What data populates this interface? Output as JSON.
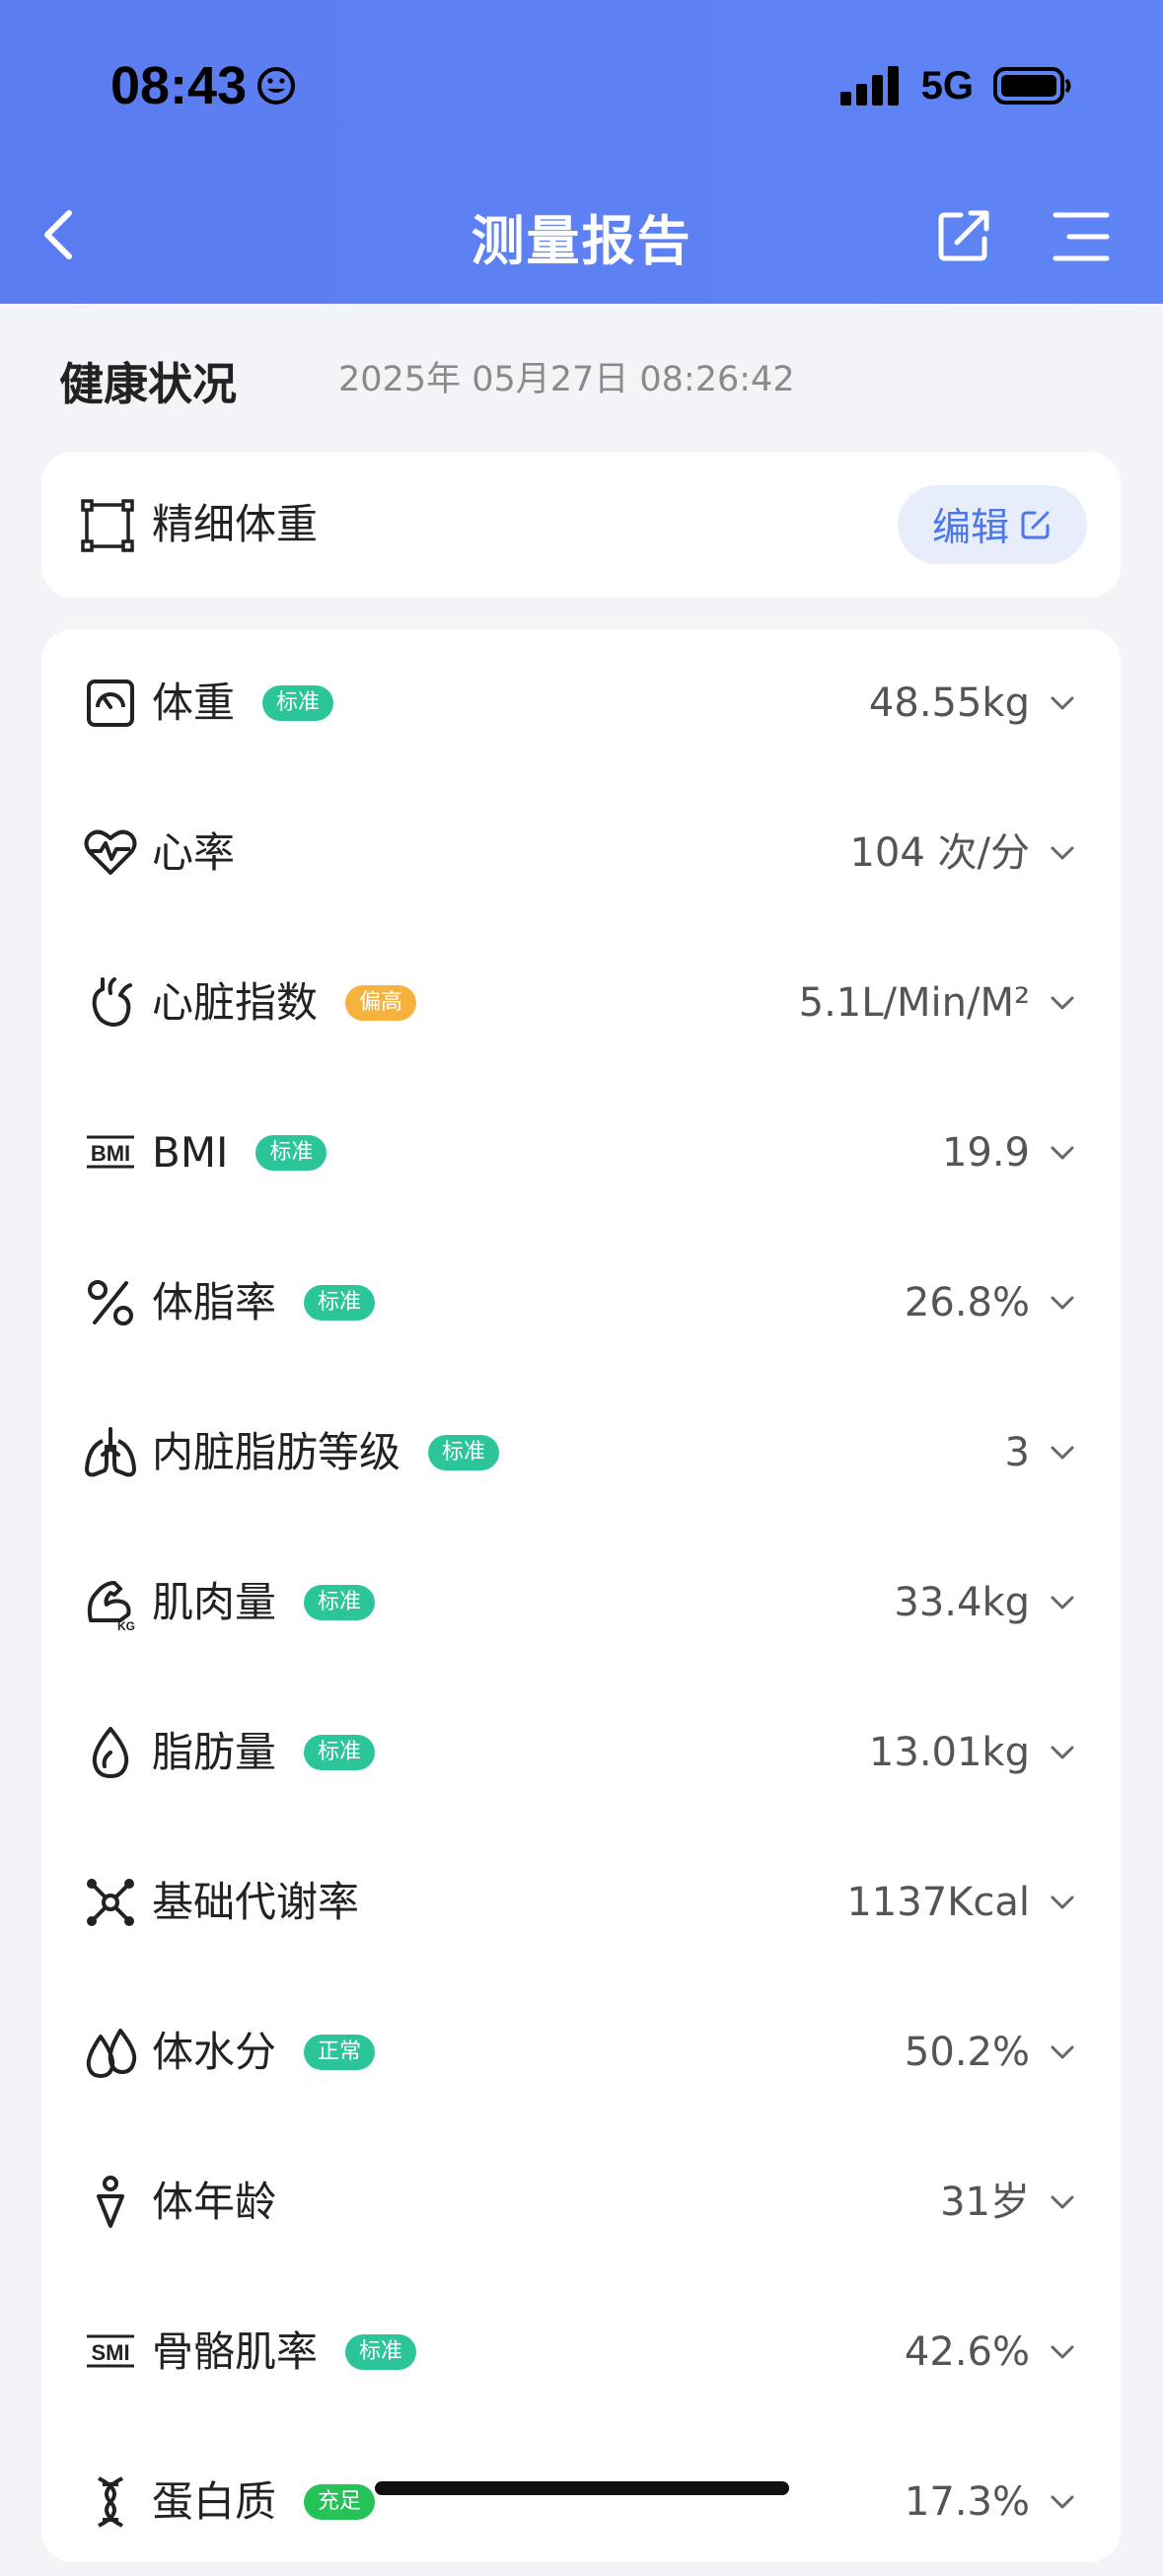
{
  "status": {
    "time": "08:43",
    "network": "5G"
  },
  "nav": {
    "title": "测量报告"
  },
  "section": {
    "title": "健康状况",
    "date": "2025年 05月27日 08:26:42"
  },
  "fine_weight": {
    "label": "精细体重",
    "edit_label": "编辑"
  },
  "colors": {
    "header": "#5b7cf0",
    "badge_green": "#2cc59a",
    "badge_orange": "#f6b23c",
    "badge_bright_green": "#25c257",
    "accent": "#4b78ee"
  },
  "metrics": [
    {
      "icon": "weight-scale-icon",
      "name": "体重",
      "badge": "标准",
      "badge_color": "#2cc59a",
      "value": "48.55kg"
    },
    {
      "icon": "heart-rate-icon",
      "name": "心率",
      "badge": "",
      "badge_color": "",
      "value": "104 次/分"
    },
    {
      "icon": "heart-icon",
      "name": "心脏指数",
      "badge": "偏高",
      "badge_color": "#f6b23c",
      "value": "5.1L/Min/M²"
    },
    {
      "icon": "bmi-icon",
      "name": "BMI",
      "badge": "标准",
      "badge_color": "#2cc59a",
      "value": "19.9"
    },
    {
      "icon": "percent-icon",
      "name": "体脂率",
      "badge": "标准",
      "badge_color": "#2cc59a",
      "value": "26.8%"
    },
    {
      "icon": "lungs-icon",
      "name": "内脏脂肪等级",
      "badge": "标准",
      "badge_color": "#2cc59a",
      "value": "3"
    },
    {
      "icon": "muscle-icon",
      "name": "肌肉量",
      "badge": "标准",
      "badge_color": "#2cc59a",
      "value": "33.4kg"
    },
    {
      "icon": "fat-drop-icon",
      "name": "脂肪量",
      "badge": "标准",
      "badge_color": "#2cc59a",
      "value": "13.01kg"
    },
    {
      "icon": "molecule-icon",
      "name": "基础代谢率",
      "badge": "",
      "badge_color": "",
      "value": "1137Kcal"
    },
    {
      "icon": "water-drops-icon",
      "name": "体水分",
      "badge": "正常",
      "badge_color": "#2cc59a",
      "value": "50.2%"
    },
    {
      "icon": "person-icon",
      "name": "体年龄",
      "badge": "",
      "badge_color": "",
      "value": "31岁"
    },
    {
      "icon": "smi-icon",
      "name": "骨骼肌率",
      "badge": "标准",
      "badge_color": "#2cc59a",
      "value": "42.6%"
    },
    {
      "icon": "dna-icon",
      "name": "蛋白质",
      "badge": "充足",
      "badge_color": "#25c257",
      "value": "17.3%"
    }
  ]
}
